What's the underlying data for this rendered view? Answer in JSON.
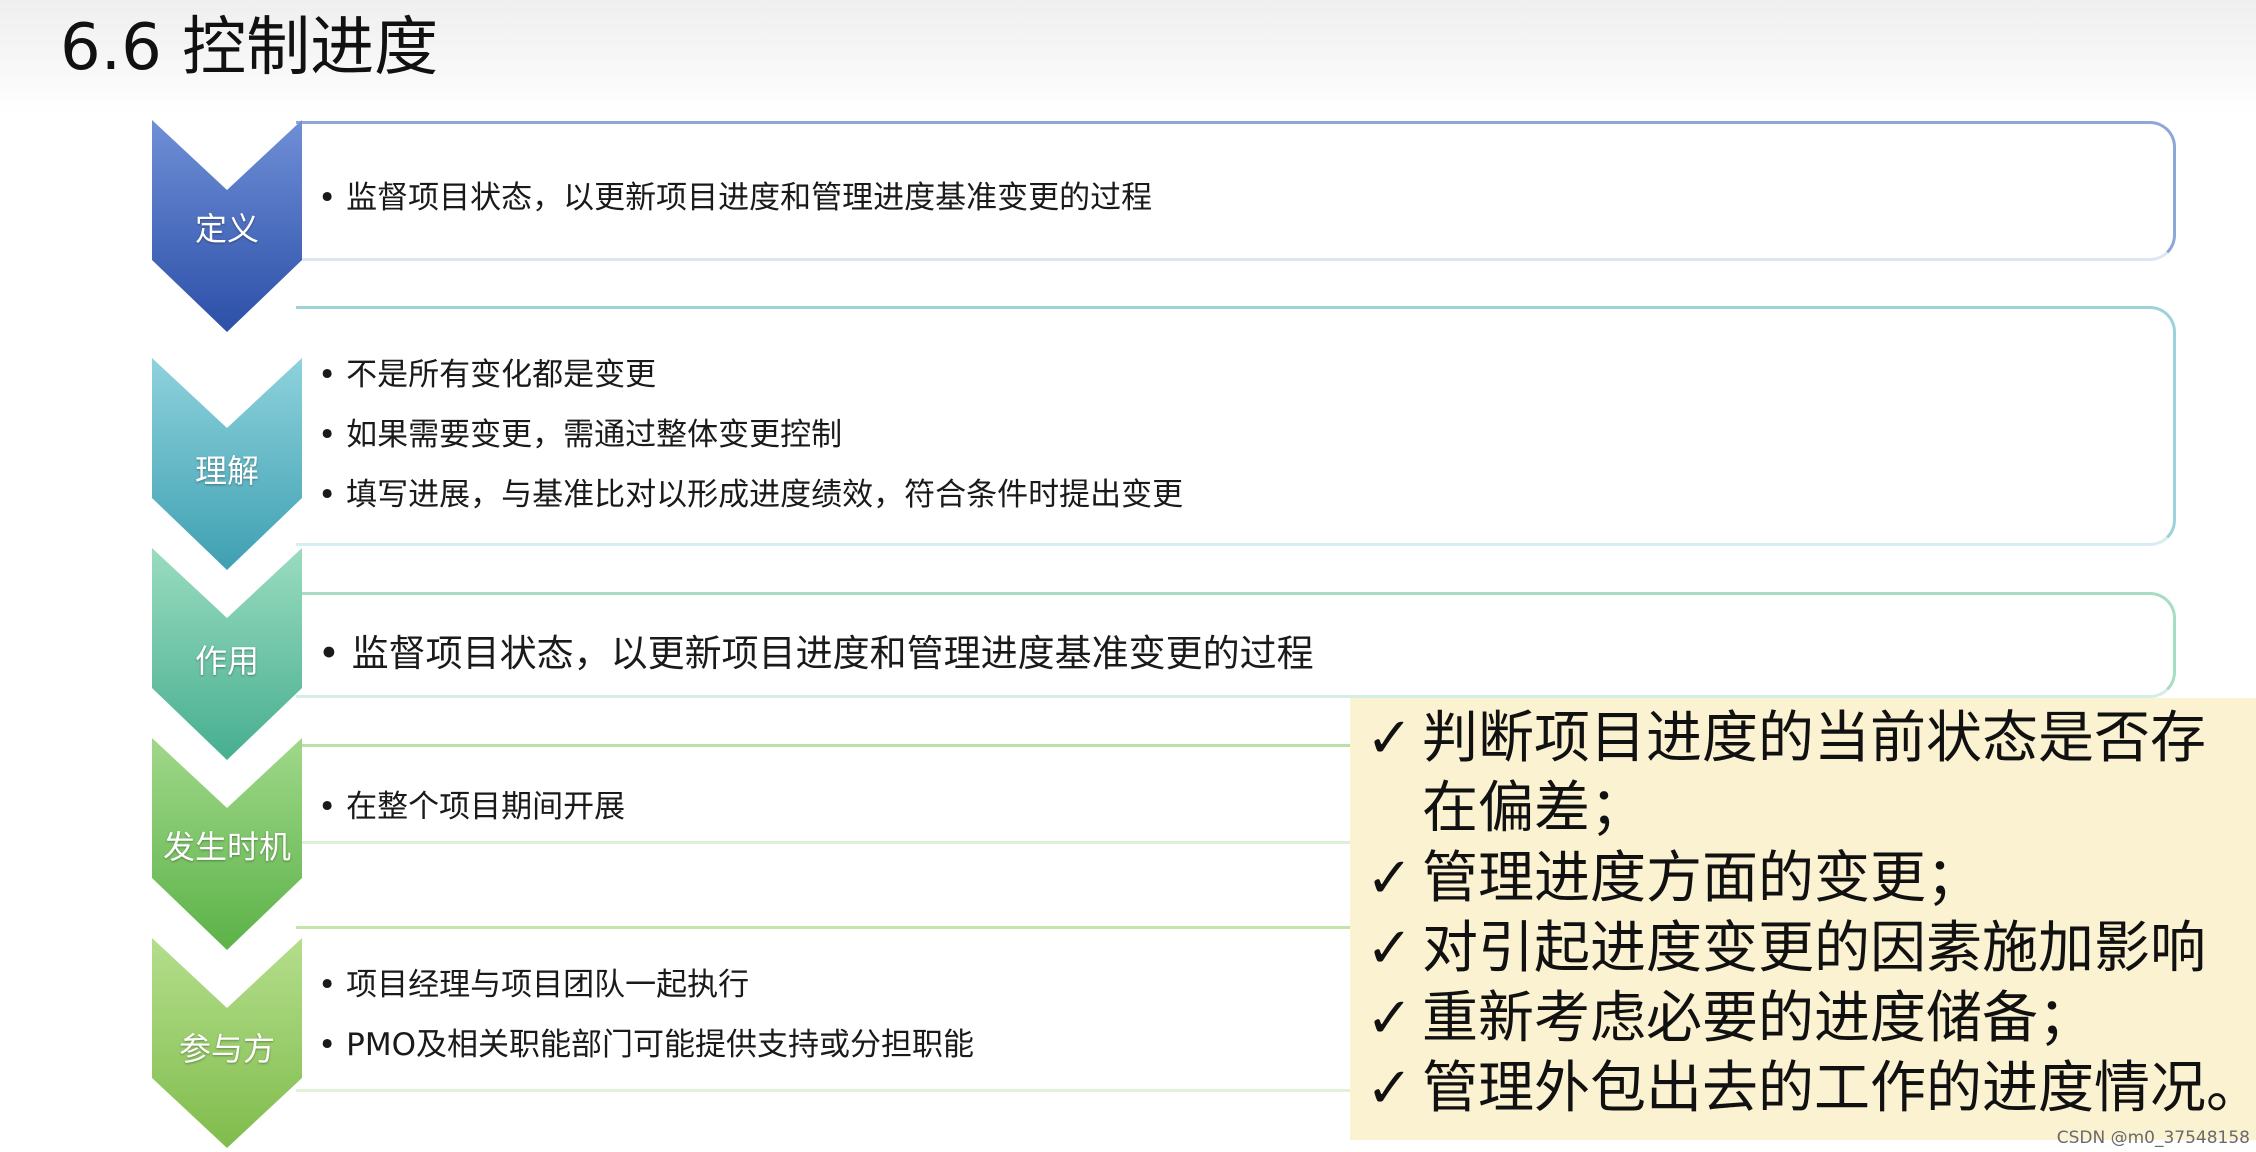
{
  "title": "6.6 控制进度",
  "steps": [
    {
      "label": "定义",
      "bullets": [
        "监督项目状态，以更新项目进度和管理进度基准变更的过程"
      ]
    },
    {
      "label": "理解",
      "bullets": [
        "不是所有变化都是变更",
        "如果需要变更，需通过整体变更控制",
        "填写进展，与基准比对以形成进度绩效，符合条件时提出变更"
      ]
    },
    {
      "label": "作用",
      "bullets": [
        "监督项目状态，以更新项目进度和管理进度基准变更的过程"
      ]
    },
    {
      "label": "发生时机",
      "bullets": [
        "在整个项目期间开展"
      ]
    },
    {
      "label": "参与方",
      "bullets": [
        "项目经理与项目团队一起执行",
        "PMO及相关职能部门可能提供支持或分担职能"
      ]
    }
  ],
  "callout": {
    "check_glyph": "✓",
    "items": [
      {
        "line1": "判断项目进度的当前状态是否存",
        "line2": "在偏差；"
      },
      {
        "line1": "管理进度方面的变更；"
      },
      {
        "line1": "对引起进度变更的因素施加影响"
      },
      {
        "line1": "重新考虑必要的进度储备；"
      },
      {
        "line1": "管理外包出去的工作的进度情况。"
      }
    ]
  },
  "watermark": "CSDN @m0_37548158",
  "colors": {
    "define": "#3a5fb8",
    "understand": "#4aa8b8",
    "purpose": "#55b8a0",
    "timing": "#6cbc56",
    "participants": "#8cc456",
    "callout_bg": "#fbf2d2"
  }
}
